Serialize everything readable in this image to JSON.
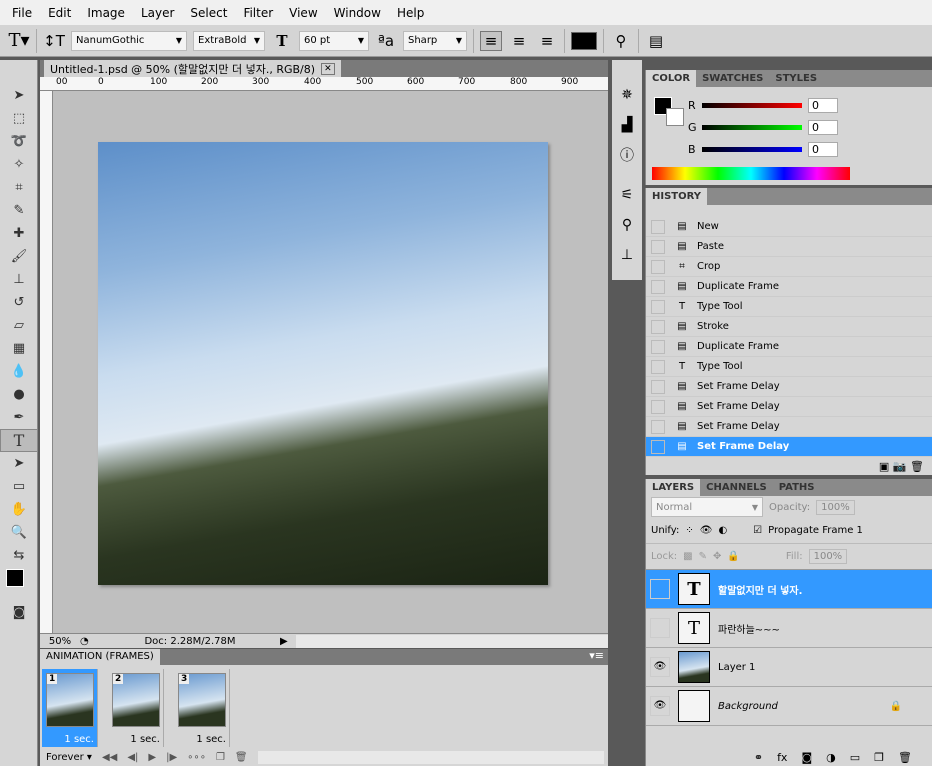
{
  "menu": [
    "File",
    "Edit",
    "Image",
    "Layer",
    "Select",
    "Filter",
    "View",
    "Window",
    "Help"
  ],
  "options": {
    "font_family": "NanumGothic",
    "font_style": "ExtraBold",
    "font_size": "60 pt",
    "antialias": "Sharp",
    "color": "#000000"
  },
  "document": {
    "tab_title": "Untitled-1.psd @ 50% (할말없지만 더 넣자., RGB/8)",
    "ruler_labels": [
      "00",
      "0",
      "100",
      "200",
      "300",
      "400",
      "500",
      "600",
      "700",
      "800",
      "900"
    ],
    "zoom": "50%",
    "doc_size": "Doc: 2.28M/2.78M"
  },
  "animation": {
    "title": "ANIMATION (FRAMES)",
    "frames": [
      {
        "n": "1",
        "delay": "1 sec."
      },
      {
        "n": "2",
        "delay": "1 sec."
      },
      {
        "n": "3",
        "delay": "1 sec."
      }
    ],
    "loop": "Forever"
  },
  "color": {
    "tabs": [
      "COLOR",
      "SWATCHES",
      "STYLES"
    ],
    "r": "0",
    "g": "0",
    "b": "0",
    "labels": [
      "R",
      "G",
      "B"
    ]
  },
  "history": {
    "tab": "HISTORY",
    "items": [
      {
        "icon": "doc",
        "label": "New"
      },
      {
        "icon": "doc",
        "label": "Paste"
      },
      {
        "icon": "crop",
        "label": "Crop"
      },
      {
        "icon": "doc",
        "label": "Duplicate Frame"
      },
      {
        "icon": "type",
        "label": "Type Tool"
      },
      {
        "icon": "doc",
        "label": "Stroke"
      },
      {
        "icon": "doc",
        "label": "Duplicate Frame"
      },
      {
        "icon": "type",
        "label": "Type Tool"
      },
      {
        "icon": "doc",
        "label": "Set Frame Delay"
      },
      {
        "icon": "doc",
        "label": "Set Frame Delay"
      },
      {
        "icon": "doc",
        "label": "Set Frame Delay"
      },
      {
        "icon": "doc",
        "label": "Set Frame Delay"
      }
    ]
  },
  "layers": {
    "tabs": [
      "LAYERS",
      "CHANNELS",
      "PATHS"
    ],
    "blend": "Normal",
    "opacity_label": "Opacity:",
    "opacity": "100%",
    "unify_label": "Unify:",
    "propagate": "Propagate Frame 1",
    "lock_label": "Lock:",
    "fill_label": "Fill:",
    "fill": "100%",
    "items": [
      {
        "name": "할말없지만 더 넣자.",
        "type": "text"
      },
      {
        "name": "파란하늘~~~",
        "type": "text"
      },
      {
        "name": "Layer 1",
        "type": "image"
      },
      {
        "name": "Background",
        "type": "bg"
      }
    ]
  }
}
